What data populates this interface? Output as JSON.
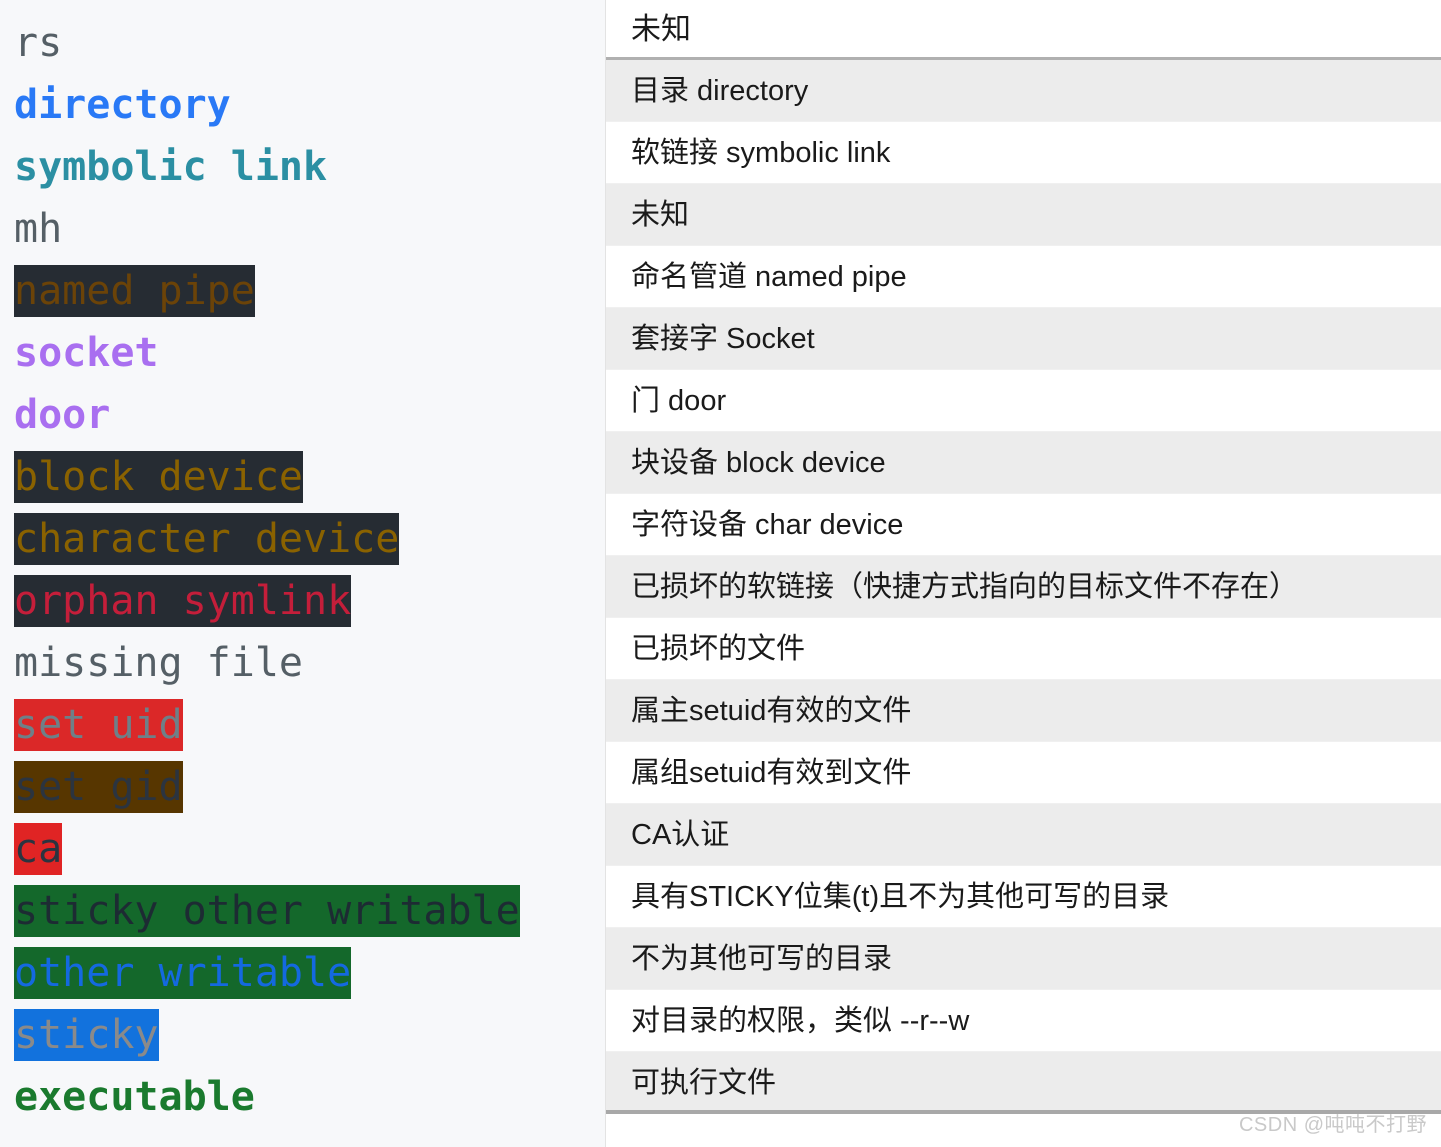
{
  "table": {
    "header": "未知",
    "rows": [
      "目录 directory",
      "软链接  symbolic link",
      "未知",
      "命名管道 named pipe",
      "套接字 Socket",
      "门 door",
      "块设备 block device",
      "字符设备 char device",
      "已损坏的软链接（快捷方式指向的目标文件不存在）",
      "已损坏的文件",
      "属主setuid有效的文件",
      "属组setuid有效到文件",
      "CA认证",
      "具有STICKY位集(t)且不为其他可写的目录",
      "不为其他可写的目录",
      "对目录的权限，类似 --r--w",
      "可执行文件"
    ]
  },
  "terminal": {
    "lines": [
      {
        "label": "rs",
        "fg": "#555f66",
        "bg": "transparent",
        "bold": false
      },
      {
        "label": "directory",
        "fg": "#2979f6",
        "bg": "transparent",
        "bold": true
      },
      {
        "label": "symbolic link",
        "fg": "#2b8fa3",
        "bg": "transparent",
        "bold": true
      },
      {
        "label": "mh",
        "fg": "#555f66",
        "bg": "transparent",
        "bold": false
      },
      {
        "label": "named pipe",
        "fg": "#6b4308",
        "bg": "#262c33",
        "bold": false
      },
      {
        "label": "socket",
        "fg": "#a96ff0",
        "bg": "transparent",
        "bold": true
      },
      {
        "label": "door",
        "fg": "#a96ff0",
        "bg": "transparent",
        "bold": true
      },
      {
        "label": "block device",
        "fg": "#8a6200",
        "bg": "#262c33",
        "bold": false
      },
      {
        "label": "character device",
        "fg": "#8a6200",
        "bg": "#262c33",
        "bold": false
      },
      {
        "label": "orphan symlink",
        "fg": "#c41e3a",
        "bg": "#262c33",
        "bold": false
      },
      {
        "label": "missing file",
        "fg": "#555f66",
        "bg": "transparent",
        "bold": false
      },
      {
        "label": "set uid",
        "fg": "#6e8088",
        "bg": "#db2828",
        "bold": false
      },
      {
        "label": "set gid",
        "fg": "#2b3440",
        "bg": "#573600",
        "bold": false
      },
      {
        "label": "ca",
        "fg": "#2b3440",
        "bg": "#e02424",
        "bold": false
      },
      {
        "label": "sticky other writable",
        "fg": "#1d2b33",
        "bg": "#14682b",
        "bold": false
      },
      {
        "label": "other writable",
        "fg": "#1469e0",
        "bg": "#14682b",
        "bold": false
      },
      {
        "label": "sticky",
        "fg": "#8a8a8a",
        "bg": "#1272dd",
        "bold": false
      },
      {
        "label": "executable",
        "fg": "#1a7a2e",
        "bg": "transparent",
        "bold": true
      }
    ]
  },
  "watermark": "CSDN @吨吨不打野"
}
